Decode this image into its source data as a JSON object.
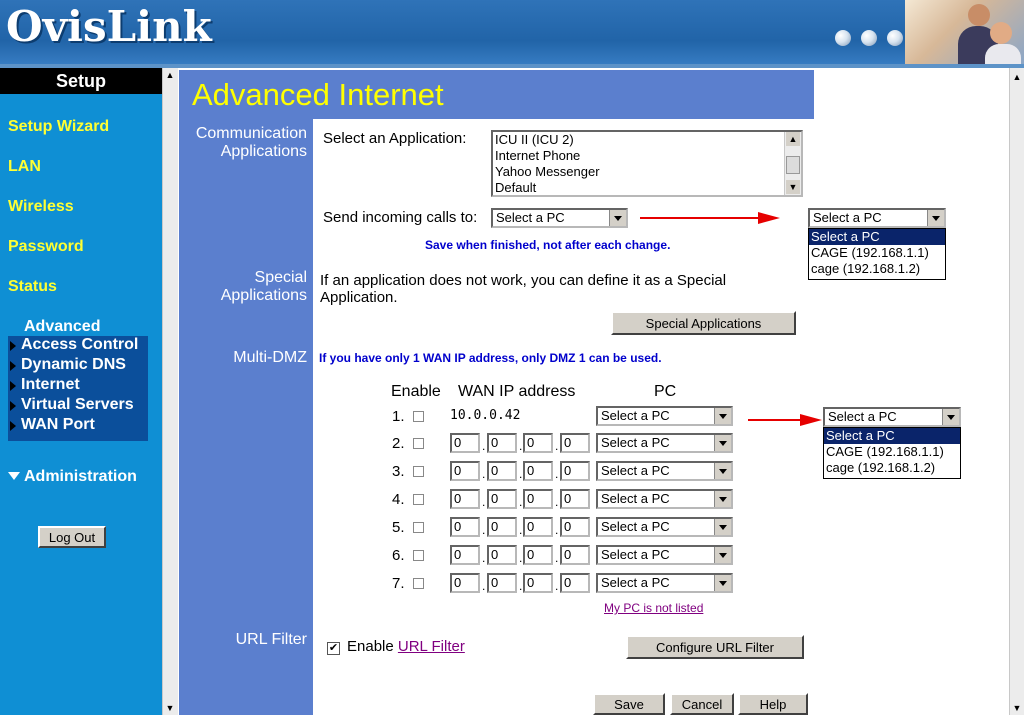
{
  "header": {
    "logo": "OvisLink"
  },
  "sidebar": {
    "heading": "Setup",
    "items": [
      "Setup Wizard",
      "LAN",
      "Wireless",
      "Password",
      "Status"
    ],
    "advanced_heading": "Advanced",
    "advanced_items": [
      "Access Control",
      "Dynamic DNS",
      "Internet",
      "Virtual Servers",
      "WAN Port"
    ],
    "administration": "Administration",
    "logout": "Log Out"
  },
  "main": {
    "title": "Advanced Internet",
    "comm": {
      "label_line1": "Communication",
      "label_line2": "Applications",
      "select_app_label": "Select an Application:",
      "apps": [
        "ICU II (ICU 2)",
        "Internet Phone",
        "Yahoo Messenger",
        "Default"
      ],
      "send_calls_label": "Send incoming calls to:",
      "send_calls_value": "Select a PC",
      "save_note": "Save when finished, not after each change."
    },
    "pc_dropdown": {
      "value": "Select a PC",
      "options": [
        "Select a PC",
        "CAGE (192.168.1.1)",
        "cage (192.168.1.2)"
      ]
    },
    "special": {
      "label_line1": "Special",
      "label_line2": "Applications",
      "text_line1": "If an application does not work, you can define it as a Special",
      "text_line2": "Application.",
      "button": "Special Applications"
    },
    "dmz": {
      "label": "Multi-DMZ",
      "note": "If you have only 1 WAN IP address, only DMZ 1 can be used.",
      "col_enable": "Enable",
      "col_wan": "WAN IP address",
      "col_pc": "PC",
      "row1": {
        "num": "1.",
        "ip": "10.0.0.42",
        "pc": "Select a PC"
      },
      "rows": [
        {
          "num": "2.",
          "o1": "0",
          "o2": "0",
          "o3": "0",
          "o4": "0",
          "pc": "Select a PC"
        },
        {
          "num": "3.",
          "o1": "0",
          "o2": "0",
          "o3": "0",
          "o4": "0",
          "pc": "Select a PC"
        },
        {
          "num": "4.",
          "o1": "0",
          "o2": "0",
          "o3": "0",
          "o4": "0",
          "pc": "Select a PC"
        },
        {
          "num": "5.",
          "o1": "0",
          "o2": "0",
          "o3": "0",
          "o4": "0",
          "pc": "Select a PC"
        },
        {
          "num": "6.",
          "o1": "0",
          "o2": "0",
          "o3": "0",
          "o4": "0",
          "pc": "Select a PC"
        },
        {
          "num": "7.",
          "o1": "0",
          "o2": "0",
          "o3": "0",
          "o4": "0",
          "pc": "Select a PC"
        }
      ],
      "not_listed": "My PC is not listed",
      "ip_separator": "."
    },
    "url_filter": {
      "label": "URL Filter",
      "enable_text": "Enable",
      "enable_link": "URL Filter",
      "checked": true,
      "configure_button": "Configure URL Filter"
    },
    "buttons": {
      "save": "Save",
      "cancel": "Cancel",
      "help": "Help"
    }
  },
  "colors": {
    "header_blue": "#2164a8",
    "sidebar_blue": "#0f8fd4",
    "sidebar_link": "#ffff33",
    "advanced_box": "#0b4f9b",
    "content_band": "#5b7fce",
    "title_yellow": "#ffff00",
    "note_blue": "#0000cc",
    "arrow_red": "#e60000"
  }
}
